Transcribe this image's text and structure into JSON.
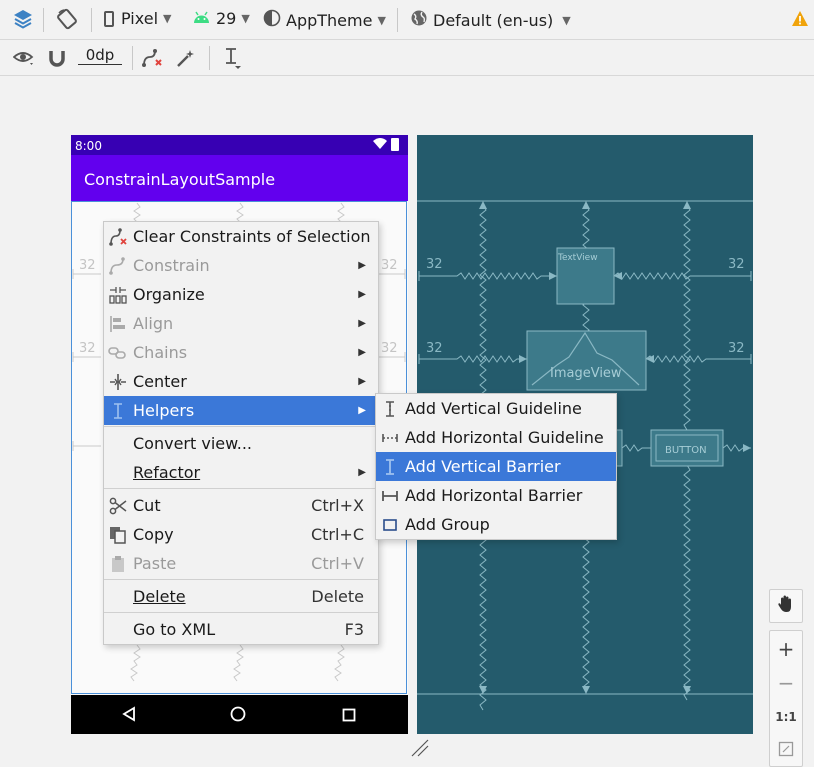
{
  "toolbar": {
    "device": "Pixel",
    "api_level": "29",
    "theme": "AppTheme",
    "locale": "Default (en-us)",
    "margin": "0dp"
  },
  "phone": {
    "status_time": "8:00",
    "app_title": "ConstrainLayoutSample",
    "margin_label": "32"
  },
  "blueprint": {
    "textview_label": "TextView",
    "imageview_label": "ImageView",
    "button_label": "BUTTON",
    "margin_label": "32"
  },
  "context_menu": {
    "items": [
      {
        "label": "Clear Constraints of Selection",
        "icon": "clear-constraints-icon",
        "enabled": true
      },
      {
        "label": "Constrain",
        "icon": "constrain-icon",
        "enabled": false,
        "submenu": true
      },
      {
        "label": "Organize",
        "icon": "organize-icon",
        "enabled": true,
        "submenu": true
      },
      {
        "label": "Align",
        "icon": "align-icon",
        "enabled": false,
        "submenu": true
      },
      {
        "label": "Chains",
        "icon": "chains-icon",
        "enabled": false,
        "submenu": true
      },
      {
        "label": "Center",
        "icon": "center-icon",
        "enabled": true,
        "submenu": true
      },
      {
        "label": "Helpers",
        "icon": "helpers-icon",
        "enabled": true,
        "submenu": true,
        "selected": true
      },
      {
        "label": "Convert view...",
        "enabled": true
      },
      {
        "label": "Refactor",
        "enabled": true,
        "submenu": true
      },
      {
        "label": "Cut",
        "icon": "scissors-icon",
        "shortcut": "Ctrl+X",
        "enabled": true
      },
      {
        "label": "Copy",
        "icon": "copy-icon",
        "shortcut": "Ctrl+C",
        "enabled": true
      },
      {
        "label": "Paste",
        "icon": "paste-icon",
        "shortcut": "Ctrl+V",
        "enabled": false
      },
      {
        "label": "Delete",
        "shortcut": "Delete",
        "enabled": true
      },
      {
        "label": "Go to XML",
        "shortcut": "F3",
        "enabled": true
      }
    ]
  },
  "helpers_submenu": {
    "items": [
      {
        "label": "Add Vertical Guideline",
        "icon": "vertical-guideline-icon"
      },
      {
        "label": "Add Horizontal Guideline",
        "icon": "horizontal-guideline-icon"
      },
      {
        "label": "Add Vertical Barrier",
        "icon": "vertical-barrier-icon",
        "selected": true
      },
      {
        "label": "Add Horizontal Barrier",
        "icon": "horizontal-barrier-icon"
      },
      {
        "label": "Add Group",
        "icon": "group-icon"
      }
    ]
  },
  "zoom_controls": {
    "actual_size": "1:1"
  },
  "colors": {
    "accent_selected": "#3b78d8",
    "status_bar": "#3700b3",
    "app_bar": "#6200ee",
    "blueprint_bg": "#245b6c",
    "blueprint_line": "#7fb2bf"
  }
}
